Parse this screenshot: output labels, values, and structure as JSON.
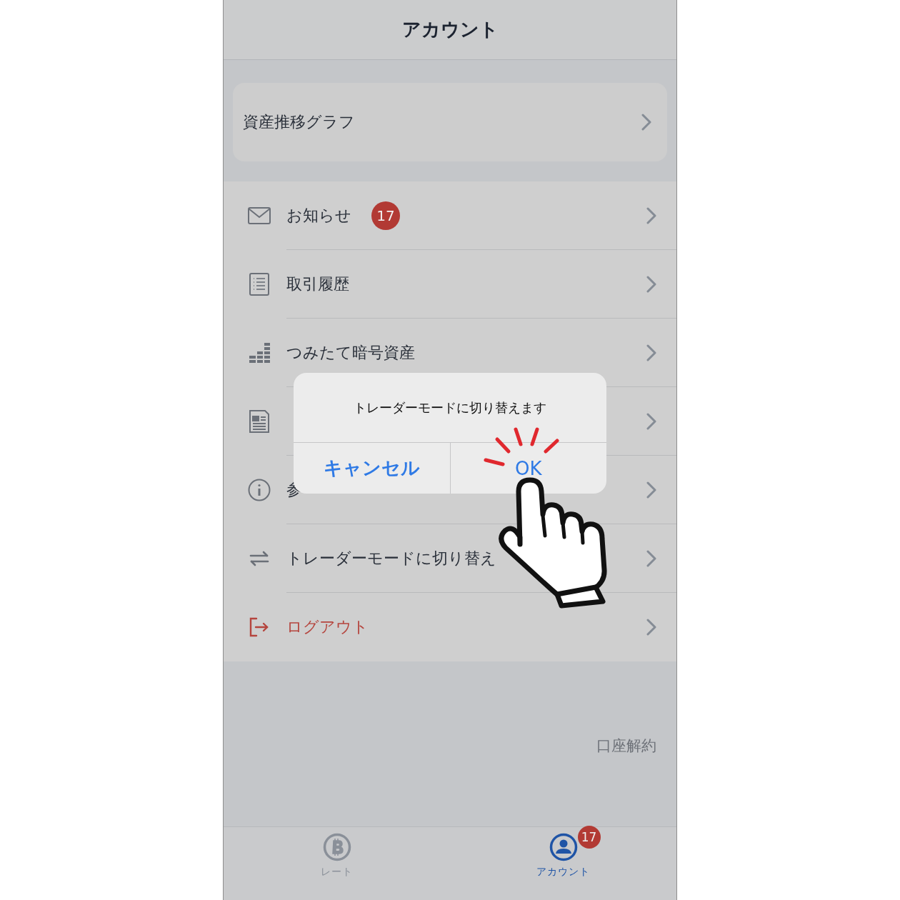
{
  "header": {
    "title": "アカウント"
  },
  "graph_link": {
    "label": "資産推移グラフ"
  },
  "menu": [
    {
      "kind": "mail",
      "label": "お知らせ",
      "badge": "17"
    },
    {
      "kind": "list",
      "label": "取引履歴"
    },
    {
      "kind": "bars",
      "label": "つみたて暗号資産"
    },
    {
      "kind": "news"
    },
    {
      "kind": "info",
      "label": "参"
    },
    {
      "kind": "swap",
      "label": "トレーダーモードに切り替え"
    },
    {
      "kind": "logout",
      "label": "ログアウト"
    }
  ],
  "close_account": "口座解約",
  "tabs": [
    {
      "kind": "bitcoin",
      "label": "レート",
      "selected": false
    },
    {
      "kind": "person",
      "label": "アカウント",
      "selected": true,
      "badge": "17"
    }
  ],
  "dialog": {
    "message": "トレーダーモードに切り替えます",
    "buttons": [
      {
        "label": "キャンセル"
      },
      {
        "label": "OK"
      }
    ]
  }
}
